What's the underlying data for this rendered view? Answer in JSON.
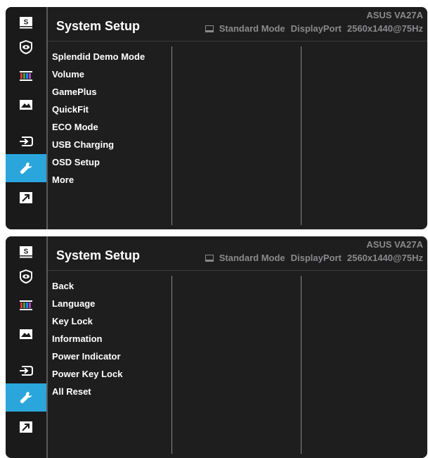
{
  "osd_top": {
    "title": "System Setup",
    "model": "ASUS  VA27A",
    "status": {
      "mode": "Standard Mode",
      "input": "DisplayPort",
      "resolution": "2560x1440@75Hz"
    },
    "rail": [
      {
        "icon": "splendid-icon",
        "active": false
      },
      {
        "icon": "eye-care-icon",
        "active": false
      },
      {
        "icon": "color-icon",
        "active": false
      },
      {
        "icon": "image-icon",
        "active": false
      },
      {
        "icon": "input-select-icon",
        "active": false
      },
      {
        "icon": "wrench-icon",
        "active": true
      },
      {
        "icon": "shortcut-icon",
        "active": false
      }
    ],
    "menu": [
      "Splendid Demo Mode",
      "Volume",
      "GamePlus",
      "QuickFit",
      "ECO Mode",
      "USB Charging",
      "OSD Setup",
      "More"
    ]
  },
  "osd_bottom": {
    "title": "System Setup",
    "model": "ASUS  VA27A",
    "status": {
      "mode": "Standard Mode",
      "input": "DisplayPort",
      "resolution": "2560x1440@75Hz"
    },
    "menu": [
      "Back",
      "Language",
      "Key Lock",
      "Information",
      "Power Indicator",
      "Power Key Lock",
      "All Reset"
    ]
  },
  "colors": {
    "accent": "#2aa6dc",
    "panel": "#1e1e1f",
    "text": "#ffffff",
    "muted": "#8a8a8c"
  }
}
